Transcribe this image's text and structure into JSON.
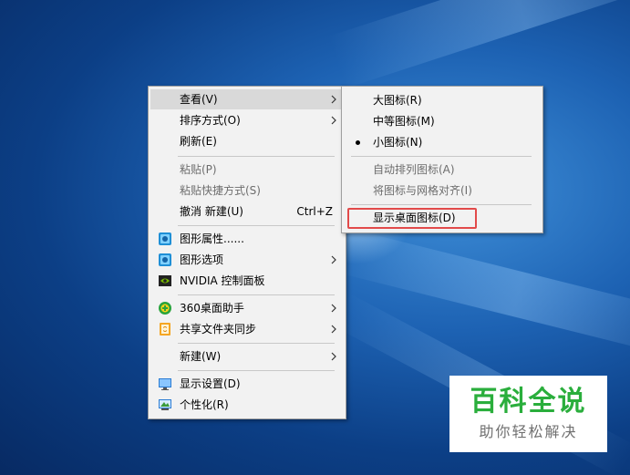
{
  "main_menu": {
    "items": [
      {
        "label": "查看(V)",
        "submenu": true,
        "state": "hover"
      },
      {
        "label": "排序方式(O)",
        "submenu": true
      },
      {
        "label": "刷新(E)"
      },
      {
        "label": "粘贴(P)",
        "disabled": true
      },
      {
        "label": "粘贴快捷方式(S)",
        "disabled": true
      },
      {
        "label": "撤消 新建(U)",
        "shortcut": "Ctrl+Z"
      },
      {
        "label": "图形属性......",
        "icon": "intel-graphics-icon"
      },
      {
        "label": "图形选项",
        "icon": "intel-graphics-icon",
        "submenu": true
      },
      {
        "label": "NVIDIA 控制面板",
        "icon": "nvidia-icon"
      },
      {
        "label": "360桌面助手",
        "icon": "360-icon",
        "submenu": true
      },
      {
        "label": "共享文件夹同步",
        "icon": "share-sync-icon",
        "submenu": true
      },
      {
        "label": "新建(W)",
        "submenu": true
      },
      {
        "label": "显示设置(D)",
        "icon": "display-icon"
      },
      {
        "label": "个性化(R)",
        "icon": "personalize-icon"
      }
    ]
  },
  "view_submenu": {
    "items": [
      {
        "label": "大图标(R)"
      },
      {
        "label": "中等图标(M)"
      },
      {
        "label": "小图标(N)",
        "selected": true
      },
      {
        "label": "自动排列图标(A)",
        "disabled": true
      },
      {
        "label": "将图标与网格对齐(I)",
        "disabled": true
      },
      {
        "label": "显示桌面图标(D)",
        "highlighted": true
      }
    ]
  },
  "watermark": {
    "title": "百科全说",
    "subtitle": "助你轻松解决"
  },
  "colors": {
    "menu_bg": "#f2f2f2",
    "hover_bg": "#d9d9d9",
    "highlight_border": "#e24a4a",
    "watermark_green": "#2aae3c"
  }
}
